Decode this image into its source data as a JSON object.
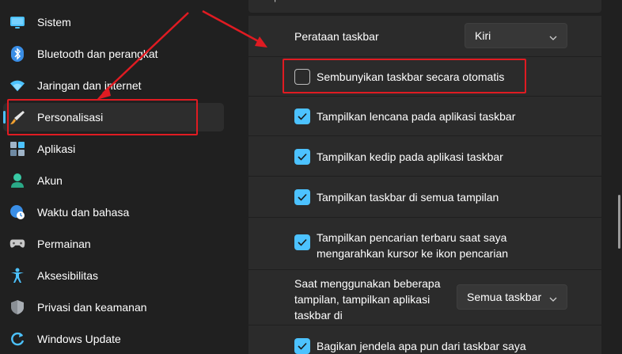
{
  "sidebar": {
    "items": [
      {
        "label": "Sistem",
        "icon": "monitor-icon"
      },
      {
        "label": "Bluetooth dan perangkat",
        "icon": "bluetooth-icon"
      },
      {
        "label": "Jaringan dan internet",
        "icon": "wifi-icon"
      },
      {
        "label": "Personalisasi",
        "icon": "paintbrush-icon",
        "selected": true
      },
      {
        "label": "Aplikasi",
        "icon": "apps-icon"
      },
      {
        "label": "Akun",
        "icon": "person-icon"
      },
      {
        "label": "Waktu dan bahasa",
        "icon": "globe-clock-icon"
      },
      {
        "label": "Permainan",
        "icon": "gamepad-icon"
      },
      {
        "label": "Aksesibilitas",
        "icon": "accessibility-icon"
      },
      {
        "label": "Privasi dan keamanan",
        "icon": "shield-icon"
      },
      {
        "label": "Windows Update",
        "icon": "update-icon"
      }
    ]
  },
  "content": {
    "section_tail_label": "tampilan",
    "alignment": {
      "label": "Perataan taskbar",
      "value": "Kiri"
    },
    "options": [
      {
        "label": "Sembunyikan taskbar secara otomatis",
        "checked": false
      },
      {
        "label": "Tampilkan lencana pada aplikasi taskbar",
        "checked": true
      },
      {
        "label": "Tampilkan kedip pada aplikasi taskbar",
        "checked": true
      },
      {
        "label": "Tampilkan taskbar di semua tampilan",
        "checked": true
      },
      {
        "label_line1": "Tampilkan pencarian terbaru saat saya",
        "label_line2": "mengarahkan kursor ke ikon pencarian",
        "checked": true
      }
    ],
    "multi_display": {
      "line1": "Saat menggunakan beberapa",
      "line2": "tampilan, tampilkan aplikasi",
      "line3": "taskbar di",
      "value": "Semua taskbar"
    },
    "share_window": {
      "label": "Bagikan jendela apa pun dari taskbar saya",
      "checked": true
    }
  },
  "colors": {
    "accent": "#4cc2ff",
    "annotation": "#e01b22",
    "background": "#202020",
    "card": "#2b2b2b"
  }
}
